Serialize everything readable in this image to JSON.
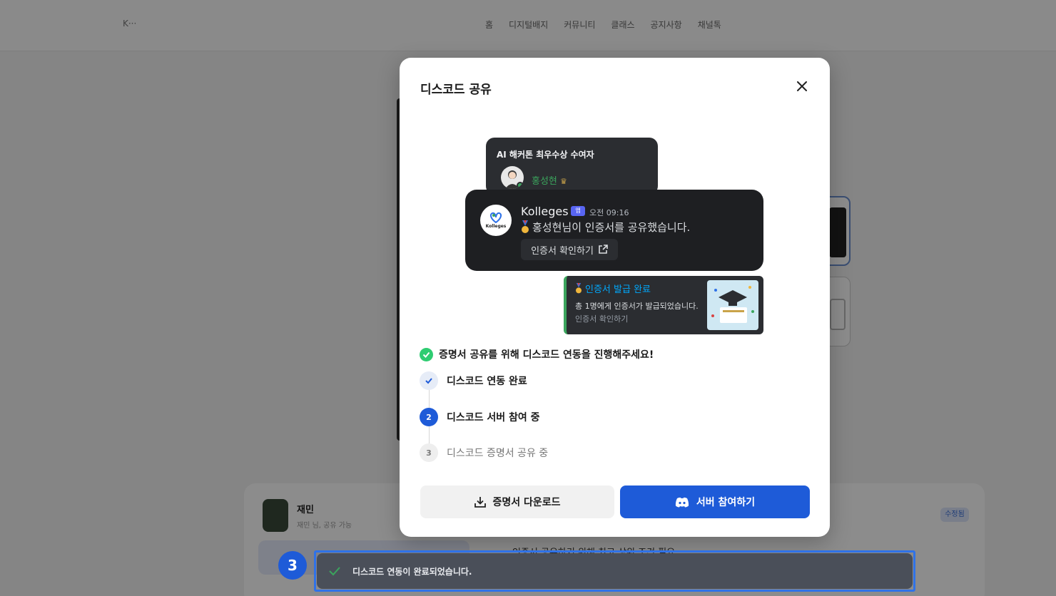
{
  "background": {
    "logo": "K···",
    "nav": [
      "홈",
      "디지털배지",
      "커뮤니티",
      "클래스",
      "공지사항",
      "채널톡"
    ],
    "profile_name": "재민",
    "profile_sub": "재민 님, 공유 가능",
    "badge": "수정됨",
    "line_text": "인증서 공유하기 위해 최고 상위 조건 필요"
  },
  "modal": {
    "title": "디스코드 공유",
    "close_icon": "close-icon",
    "preview": {
      "back_card_title": "AI 해커톤 최우수상 수여자",
      "back_card_user": "홍성현",
      "bot_name": "Kolleges",
      "bot_tag": "앱",
      "bot_time": "오전 09:16",
      "bot_avatar_label": "Kolleges",
      "bot_message": "홍성현님이 인증서를 공유했습니다.",
      "bot_button": "인증서 확인하기",
      "notif_title": "인증서 발급 완료",
      "notif_body": "총 1명에게 인증서가 발급되었습니다.",
      "notif_link": "인증서 확인하기"
    },
    "notice": "증명서 공유를 위해 디스코드 연동을 진행해주세요!",
    "steps": [
      {
        "label": "디스코드 연동 완료",
        "state": "done"
      },
      {
        "num": "2",
        "label": "디스코드 서버 참여 중",
        "state": "active"
      },
      {
        "num": "3",
        "label": "디스코드 증명서 공유 중",
        "state": "pending"
      }
    ],
    "download_button": "증명서 다운로드",
    "join_button": "서버 참여하기"
  },
  "toast": {
    "message": "디스코드 연동이 완료되었습니다.",
    "marker": "3"
  },
  "colors": {
    "primary": "#1e5bd8",
    "success": "#2ecc71",
    "discord_dark": "#1e1f22",
    "toast_bg": "#4a4f59",
    "highlight": "#2f72e8"
  }
}
